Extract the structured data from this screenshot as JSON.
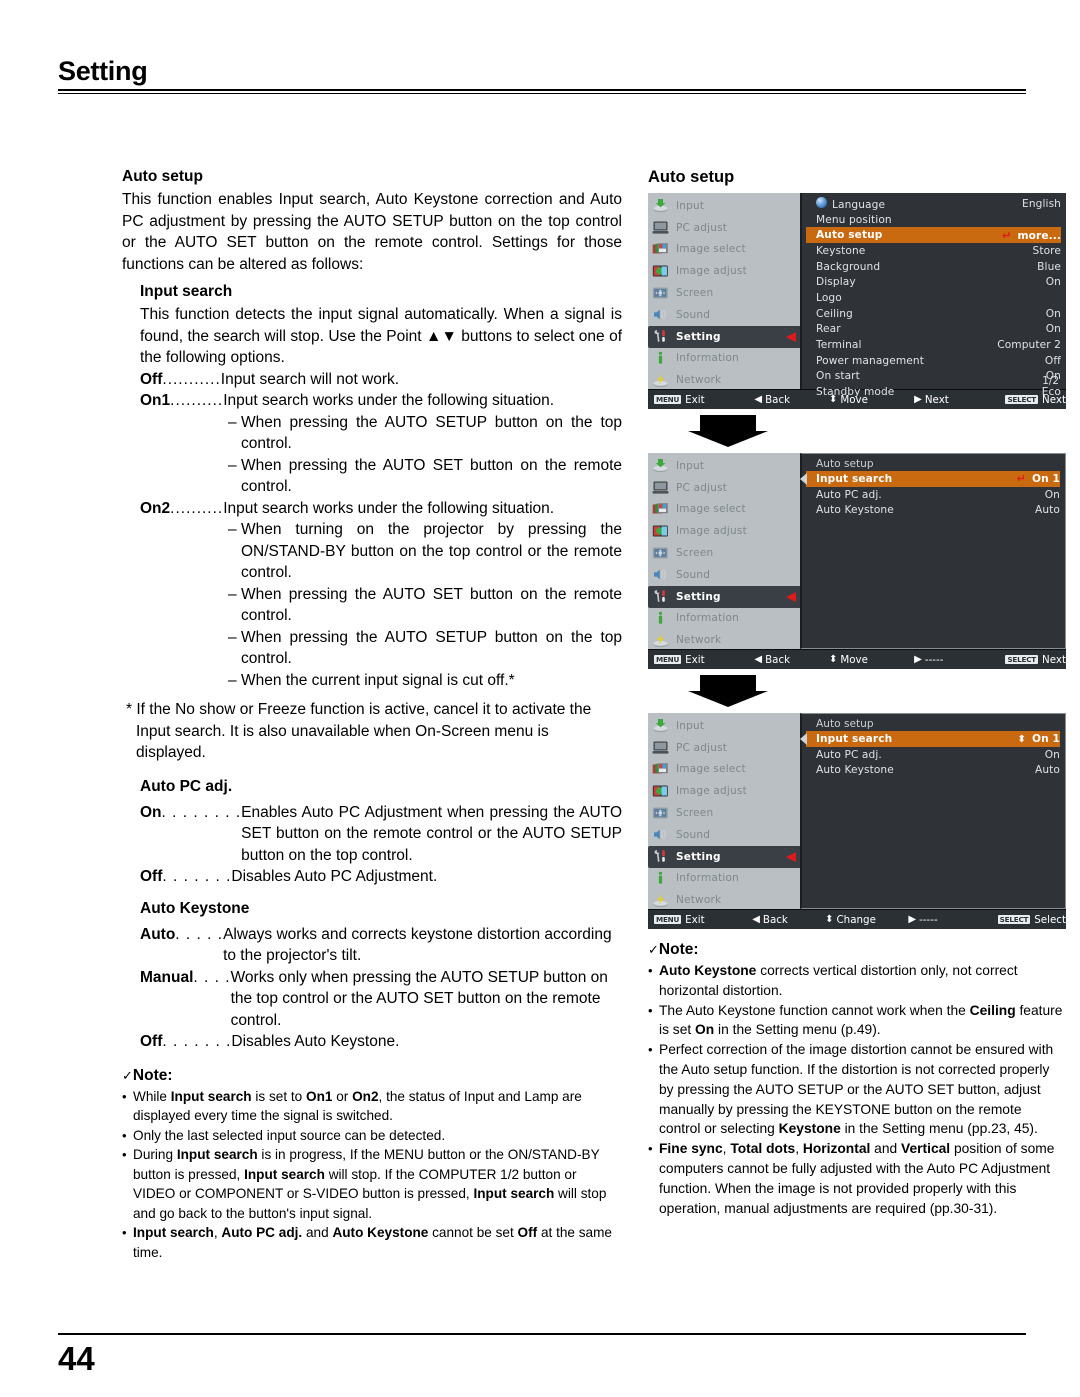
{
  "header": {
    "title": "Setting"
  },
  "footer": {
    "page_number": "44"
  },
  "left": {
    "auto_setup_heading": "Auto setup",
    "auto_setup_para": "This function enables Input search, Auto Keystone correction and Auto PC adjustment by pressing the AUTO SETUP button on the top control or the AUTO SET button on the remote control. Settings for those functions can be altered as follows:",
    "input_search_heading": "Input search",
    "input_search_para": "This function detects the input signal automatically. When a signal is found, the search will stop. Use the Point ▲▼ buttons to select one of the following options.",
    "input_search_options": [
      {
        "term": "Off",
        "dots": "...........",
        "desc": "Input search will not work.",
        "subs": []
      },
      {
        "term": "On1",
        "dots": "..........",
        "desc": "Input search works under the following situation.",
        "subs": [
          "When pressing the AUTO SETUP button on the top control.",
          "When pressing the AUTO SET button on the remote control."
        ]
      },
      {
        "term": "On2",
        "dots": "..........",
        "desc": "Input search works under the following situation.",
        "subs": [
          "When turning on the projector by pressing the ON/STAND-BY button on the top control or the remote control.",
          "When pressing the AUTO SET button on the remote control.",
          "When pressing the AUTO SETUP button on the top control.",
          "When the current input signal is cut off.*"
        ]
      }
    ],
    "footnote": "* If the No show or Freeze function is active, cancel it to activate the Input search. It is also unavailable when On-Screen menu is displayed.",
    "auto_pc_heading": "Auto PC adj.",
    "auto_pc_options": [
      {
        "term": "On",
        "dots": ". . . . . . . .",
        "desc": "Enables Auto PC Adjustment when pressing the AUTO SET button on the remote control or the AUTO SETUP button on the top control."
      },
      {
        "term": "Off",
        "dots": " . . . . . . .",
        "desc": "Disables Auto PC Adjustment."
      }
    ],
    "auto_keystone_heading": "Auto Keystone",
    "auto_keystone_options": [
      {
        "term": "Auto",
        "dots": " . . . . . ",
        "desc": "Always works and corrects keystone distortion according to the projector's tilt."
      },
      {
        "term": "Manual",
        "dots": " . . . .",
        "desc": "Works only when pressing the AUTO SETUP button on the top control or the AUTO SET button on the remote control."
      },
      {
        "term": "Off",
        "dots": " . . . . . . .",
        "desc": "Disables Auto Keystone."
      }
    ],
    "note_title": "Note:",
    "note_check": "✓",
    "notes": [
      "While <b>Input search</b> is set to <b>On1</b> or <b>On2</b>, the status of Input and Lamp are displayed every time the signal is switched.",
      "Only the last selected input source can be detected.",
      "During <b>Input search</b> is in progress, If the MENU button or the ON/STAND-BY button is pressed, <b>Input search</b> will stop. If the COMPUTER 1/2 button or VIDEO or COMPONENT or S-VIDEO button is pressed, <b>Input search</b> will stop and go back to the button's input signal.",
      "<b>Input search</b>, <b>Auto PC adj.</b> and <b>Auto Keystone</b> cannot be set <b>Off</b> at the same time."
    ]
  },
  "right": {
    "title": "Auto setup",
    "sidebar_items": [
      {
        "label": "Input",
        "icon": "input-icon"
      },
      {
        "label": "PC adjust",
        "icon": "pc-adjust-icon"
      },
      {
        "label": "Image select",
        "icon": "image-select-icon"
      },
      {
        "label": "Image adjust",
        "icon": "image-adjust-icon"
      },
      {
        "label": "Screen",
        "icon": "screen-icon"
      },
      {
        "label": "Sound",
        "icon": "sound-icon"
      },
      {
        "label": "Setting",
        "icon": "setting-icon"
      },
      {
        "label": "Information",
        "icon": "information-icon"
      },
      {
        "label": "Network",
        "icon": "network-icon"
      }
    ],
    "sidebar_selected_index": 6,
    "osd1": {
      "rows": [
        {
          "name": "Language",
          "value": "English",
          "globe": true
        },
        {
          "name": "Menu position",
          "value": ""
        },
        {
          "name": "Auto setup",
          "value": "more...",
          "highlight": true,
          "enter": true
        },
        {
          "name": "Keystone",
          "value": "Store"
        },
        {
          "name": "Background",
          "value": "Blue"
        },
        {
          "name": "Display",
          "value": "On"
        },
        {
          "name": "Logo",
          "value": ""
        },
        {
          "name": "Ceiling",
          "value": "On"
        },
        {
          "name": "Rear",
          "value": "On"
        },
        {
          "name": "Terminal",
          "value": "Computer 2"
        },
        {
          "name": "Power management",
          "value": "Off"
        },
        {
          "name": "On start",
          "value": "On"
        },
        {
          "name": "Standby mode",
          "value": "Eco"
        }
      ],
      "page_indicator": "1/2",
      "bar": [
        {
          "key": "MENU",
          "label": "Exit"
        },
        {
          "glyph": "◀",
          "label": "Back"
        },
        {
          "glyph": "⬍",
          "label": "Move"
        },
        {
          "glyph": "▶",
          "label": "Next"
        },
        {
          "key": "SELECT",
          "label": "Next"
        }
      ]
    },
    "osd2": {
      "submenu_title": "Auto setup",
      "rows": [
        {
          "name": "Input search",
          "value": "On 1",
          "highlight": true,
          "enter": true
        },
        {
          "name": "Auto PC adj.",
          "value": "On"
        },
        {
          "name": "Auto Keystone",
          "value": "Auto"
        }
      ],
      "bar": [
        {
          "key": "MENU",
          "label": "Exit"
        },
        {
          "glyph": "◀",
          "label": "Back"
        },
        {
          "glyph": "⬍",
          "label": "Move"
        },
        {
          "glyph": "▶",
          "label": "-----"
        },
        {
          "key": "SELECT",
          "label": "Next"
        }
      ]
    },
    "osd3": {
      "submenu_title": "Auto setup",
      "rows": [
        {
          "name": "Input search",
          "value": "On 1",
          "highlight": true,
          "updown": true
        },
        {
          "name": "Auto PC adj.",
          "value": "On"
        },
        {
          "name": "Auto Keystone",
          "value": "Auto"
        }
      ],
      "bar": [
        {
          "key": "MENU",
          "label": "Exit"
        },
        {
          "glyph": "◀",
          "label": "Back"
        },
        {
          "glyph": "⬍",
          "label": "Change"
        },
        {
          "glyph": "▶",
          "label": "-----"
        },
        {
          "key": "SELECT",
          "label": "Select"
        }
      ]
    },
    "note_title": "Note:",
    "note_check": "✓",
    "notes": [
      "<b>Auto Keystone</b> corrects vertical distortion only, not correct horizontal distortion.",
      "The Auto Keystone function cannot work when the <b>Ceiling</b> feature is set <b>On</b> in the Setting menu (p.49).",
      "Perfect correction of the image distortion cannot be ensured with the Auto setup function. If the distortion is not corrected properly by pressing the AUTO SETUP or the AUTO SET button, adjust manually by pressing the KEYSTONE button on the remote control or selecting <b>Keystone</b> in the Setting menu (pp.23, 45).",
      "<b>Fine sync</b>, <b>Total dots</b>, <b>Horizontal</b> and <b>Vertical</b> position of some computers cannot be fully adjusted with the Auto PC Adjustment function. When the image is not provided properly with this operation, manual adjustments are required (pp.30-31)."
    ]
  },
  "colors": {
    "osd_highlight": "#c96a10",
    "osd_panel_bg": "#2f3338",
    "osd_sidebar_bg": "#b9bfc2",
    "osd_selected_item_bg": "#3a3f45",
    "caret_red": "#e01b1b"
  }
}
